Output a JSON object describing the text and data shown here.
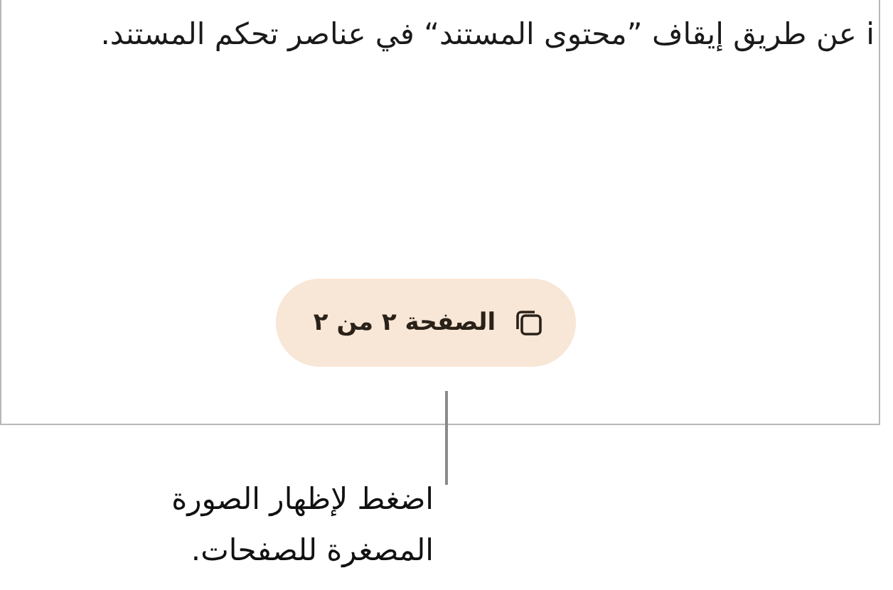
{
  "document": {
    "text": "i عن طريق إيقاف ”محتوى المستند“ في عناصر تحكم المستند."
  },
  "page_indicator": {
    "label": "الصفحة ٢ من ٢"
  },
  "callout": {
    "text": "اضغط لإظهار الصورة المصغرة للصفحات."
  }
}
